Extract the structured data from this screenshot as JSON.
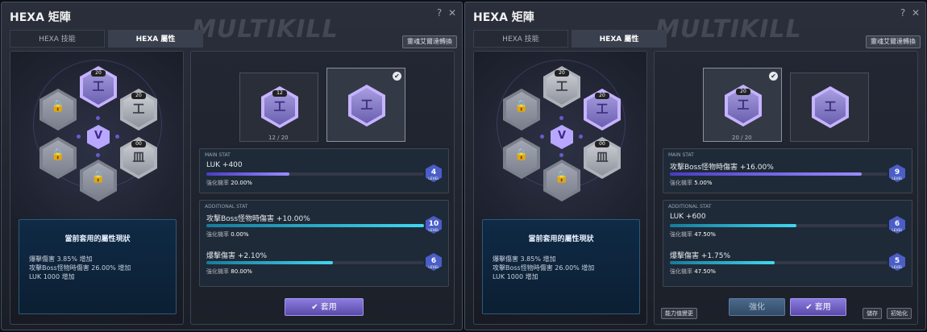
{
  "left": {
    "title": "HEXA 矩陣",
    "help": "?",
    "close": "✕",
    "watermark": "MULTIKILL",
    "tabs": [
      "HEXA 技能",
      "HEXA 屬性"
    ],
    "spirit_button": "靈魂艾爾達轉換",
    "status": {
      "heading": "當前套用的屬性現狀",
      "lines": [
        "爆擊傷害 3.85% 增加",
        "攻擊Boss怪物時傷害 26.00% 增加",
        "LUK 1000 增加"
      ]
    },
    "slot_progress": "12 / 20",
    "main_stat": {
      "header": "MAIN STAT",
      "name": "LUK +400",
      "rate_label": "強化機率",
      "rate": "20.00%",
      "level": "4",
      "level_sub": "LEVEL",
      "fill_pct": 0.38
    },
    "additional": {
      "header": "ADDITIONAL STAT",
      "rows": [
        {
          "name": "攻擊Boss怪物時傷害 +10.00%",
          "rate_label": "強化機率",
          "rate": "0.00%",
          "level": "10",
          "fill_pct": 1.0
        },
        {
          "name": "爆擊傷害 +2.10%",
          "rate_label": "強化機率",
          "rate": "80.00%",
          "level": "6",
          "fill_pct": 0.58
        }
      ]
    },
    "apply_button": "✔ 套用"
  },
  "right": {
    "title": "HEXA 矩陣",
    "help": "?",
    "close": "✕",
    "watermark": "MULTIKILL",
    "tabs": [
      "HEXA 技能",
      "HEXA 屬性"
    ],
    "spirit_button": "靈魂艾爾達轉換",
    "status": {
      "heading": "當前套用的屬性現狀",
      "lines": [
        "爆擊傷害 3.85% 增加",
        "攻擊Boss怪物時傷害 26.00% 增加",
        "LUK 1000 增加"
      ]
    },
    "slot_progress": "20 / 20",
    "main_stat": {
      "header": "MAIN STAT",
      "name": "攻擊Boss怪物時傷害 +16.00%",
      "rate_label": "強化機率",
      "rate": "5.00%",
      "level": "9",
      "level_sub": "LEVEL",
      "fill_pct": 0.88
    },
    "additional": {
      "header": "ADDITIONAL STAT",
      "rows": [
        {
          "name": "LUK +600",
          "rate_label": "強化機率",
          "rate": "47.50%",
          "level": "6",
          "fill_pct": 0.58
        },
        {
          "name": "爆擊傷害 +1.75%",
          "rate_label": "強化機率",
          "rate": "47.50%",
          "level": "5",
          "fill_pct": 0.48
        }
      ]
    },
    "buttons": {
      "ability": "能力值變更",
      "enhance": "強化",
      "apply": "✔ 套用",
      "save": "儲存",
      "reset": "初始化"
    }
  },
  "colors": {
    "accent_purple": "#8c7ce0",
    "bar_cyan": "#40d8f0",
    "bar_purple": "#9a8cff",
    "status_bg": "#0f2a45"
  }
}
